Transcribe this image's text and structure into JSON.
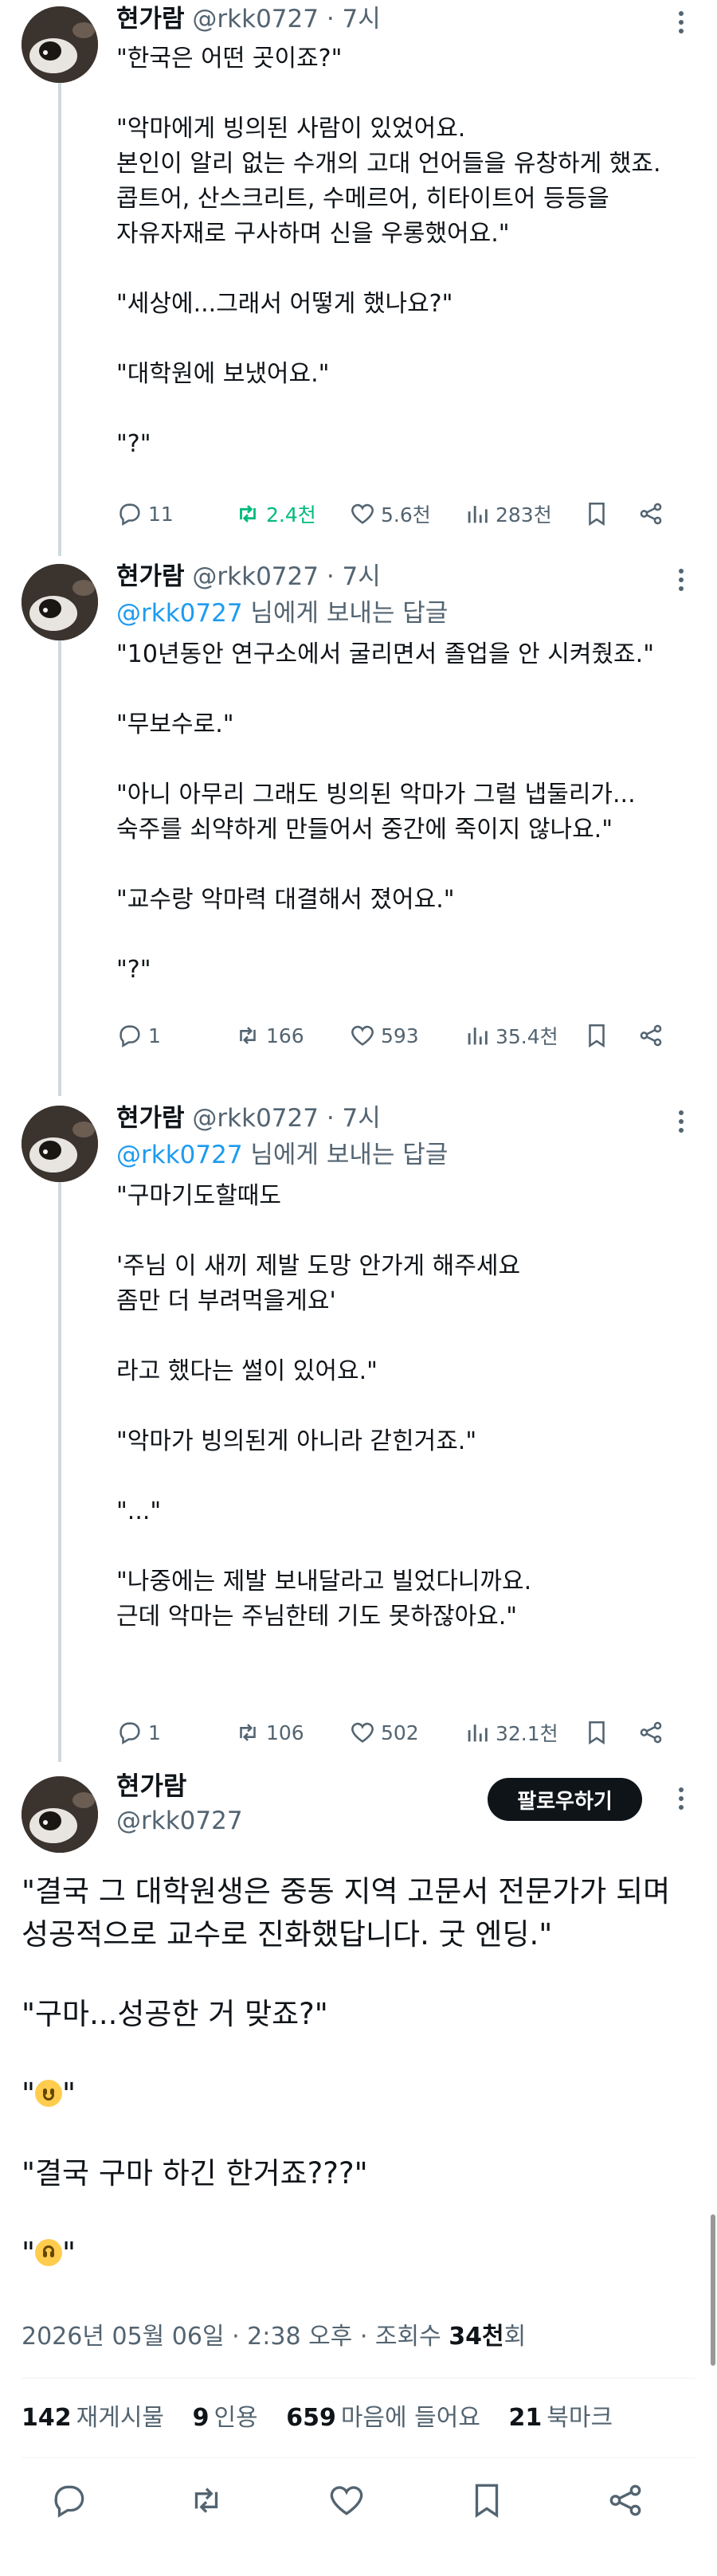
{
  "user": {
    "name": "현가람",
    "handle": "@rkk0727",
    "time": "· 7시"
  },
  "reply_prefix_mention": "@rkk0727",
  "reply_suffix": " 님에게 보내는 답글",
  "tweets": [
    {
      "body": [
        "\"한국은 어떤 곳이죠?\"",
        "\"악마에게 빙의된 사람이 있었어요.\n본인이 알리 없는 수개의 고대 언어들을 유창하게 했죠.\n콥트어, 산스크리트, 수메르어, 히타이트어 등등을\n자유자재로 구사하며 신을 우롱했어요.\"",
        "\"세상에...그래서 어떻게 했나요?\"",
        "\"대학원에 보냈어요.\"",
        "\"?\""
      ],
      "stats": {
        "replies": "11",
        "retweets": "2.4천",
        "likes": "5.6천",
        "views": "283천"
      }
    },
    {
      "body": [
        "\"10년동안 연구소에서 굴리면서 졸업을 안 시켜줬죠.\"",
        "\"무보수로.\"",
        "\"아니 아무리 그래도 빙의된 악마가 그럴 냅둘리가...\n숙주를 쇠약하게 만들어서 중간에 죽이지 않나요.\"",
        "\"교수랑 악마력 대결해서 졌어요.\"",
        "\"?\""
      ],
      "stats": {
        "replies": "1",
        "retweets": "166",
        "likes": "593",
        "views": "35.4천"
      }
    },
    {
      "body": [
        "\"구마기도할때도",
        "'주님 이 새끼 제발 도망 안가게 해주세요\n좀만 더 부려먹을게요'",
        "라고 했다는 썰이 있어요.\"",
        "\"악마가 빙의된게 아니라 갇힌거죠.\"",
        "\"...\"",
        "\"나중에는 제발 보내달라고 빌었다니까요.\n근데 악마는 주님한테 기도 못하잖아요.\""
      ],
      "stats": {
        "replies": "1",
        "retweets": "106",
        "likes": "502",
        "views": "32.1천"
      }
    }
  ],
  "main_tweet": {
    "follow_label": "팔로우하기",
    "p1": "\"결국 그 대학원생은 중동 지역 고문서 전문가가 되며\n성공적으로 교수로 진화했답니다. 굿 엔딩.\"",
    "p2": "\"구마...성공한 거 맞죠?\"",
    "p3_open": "\"",
    "p3_close": "\"",
    "p4": "\"결국 구마 하긴 한거죠???\"",
    "p5_open": "\"",
    "p5_close": "\"",
    "emoji_1": "slightly-smiling-face",
    "emoji_2": "upside-down-face",
    "date": "2026년 05월 06일 · 2:38 오후 · 조회수 ",
    "views_bold": "34천",
    "views_suffix": "회",
    "reposts_count": "142",
    "reposts_label": "재게시물",
    "quotes_count": "9",
    "quotes_label": "인용",
    "likes_count": "659",
    "likes_label": "마음에 들어요",
    "bookmarks_count": "21",
    "bookmarks_label": "북마크"
  },
  "colors": {
    "text": "#0f1419",
    "secondary": "#536471",
    "link": "#1d9bf0",
    "retweet_active": "#00ba7c",
    "thread_line": "#cfd9de"
  }
}
